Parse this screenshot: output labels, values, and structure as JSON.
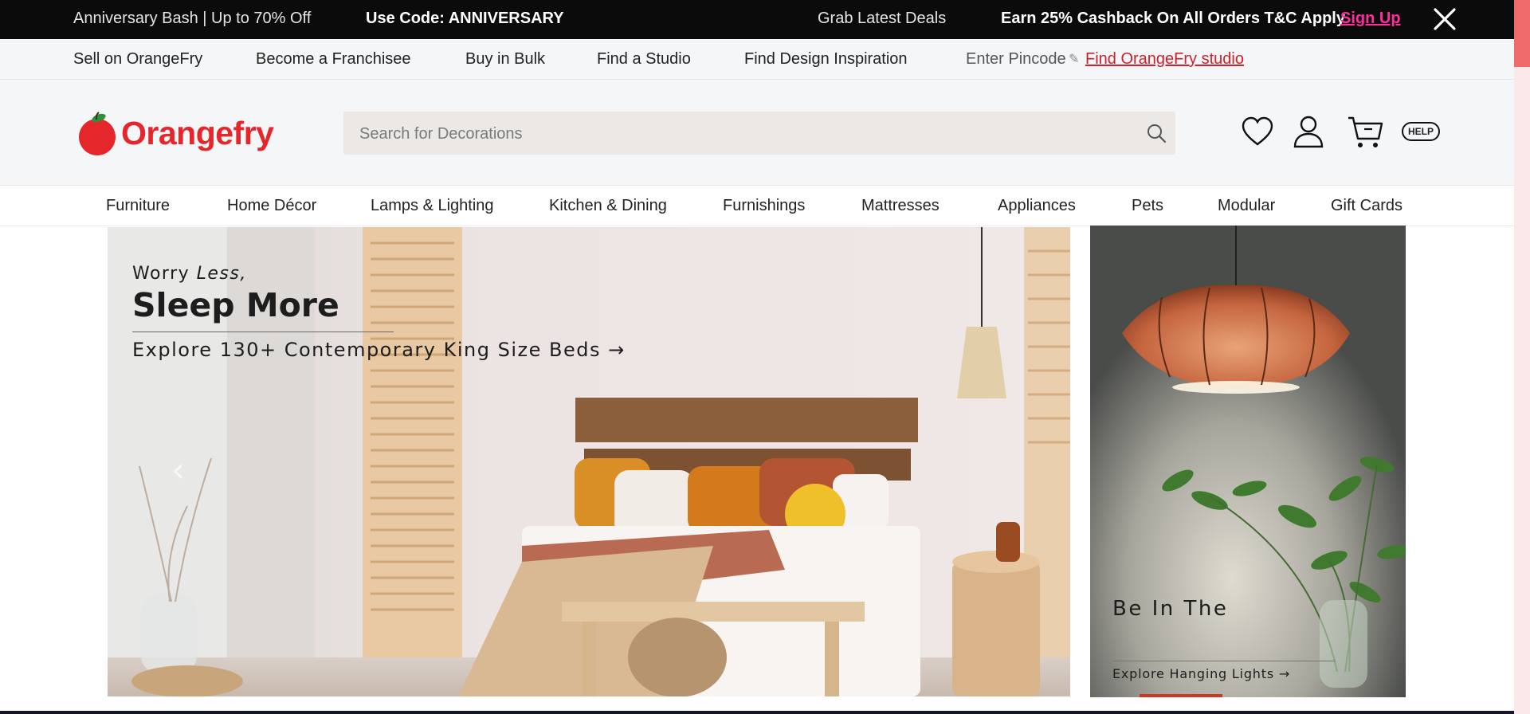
{
  "promo": {
    "anniversary": "Anniversary Bash | Up to 70% Off",
    "code": "Use Code: ANNIVERSARY",
    "deals": "Grab Latest Deals",
    "cashback": "Earn 25% Cashback On All Orders T&C Apply",
    "signup": "Sign Up"
  },
  "utility": {
    "links": [
      "Sell on OrangeFry",
      "Become a Franchisee",
      "Buy in Bulk",
      "Find a Studio",
      "Find Design Inspiration"
    ],
    "pincode": "Enter Pincode",
    "studio_link": "Find OrangeFry studio"
  },
  "header": {
    "logo_text": "Orangefry",
    "search_placeholder": "Search for Decorations",
    "help_label": "HELP"
  },
  "categories": [
    "Furniture",
    "Home Décor",
    "Lamps & Lighting",
    "Kitchen & Dining",
    "Furnishings",
    "Mattresses",
    "Appliances",
    "Pets",
    "Modular",
    "Gift Cards"
  ],
  "hero": {
    "line1_a": "Worry ",
    "line1_b": "Less,",
    "headline": "Sleep More",
    "cta": "Explore 130+ Contemporary King Size Beds",
    "arrow": "→"
  },
  "side_banner": {
    "headline": "Be In The",
    "cta": "Explore Hanging Lights",
    "arrow": "→"
  },
  "colors": {
    "brand": "#e5262b",
    "promo_bg": "#0b0b0b",
    "signup": "#ff2e9b",
    "studio_link": "#d1202a"
  },
  "icons": [
    "close-icon",
    "pencil-icon",
    "search-icon",
    "heart-icon",
    "user-icon",
    "cart-icon",
    "help-icon",
    "chevron-left-icon",
    "arrow-right-icon"
  ]
}
